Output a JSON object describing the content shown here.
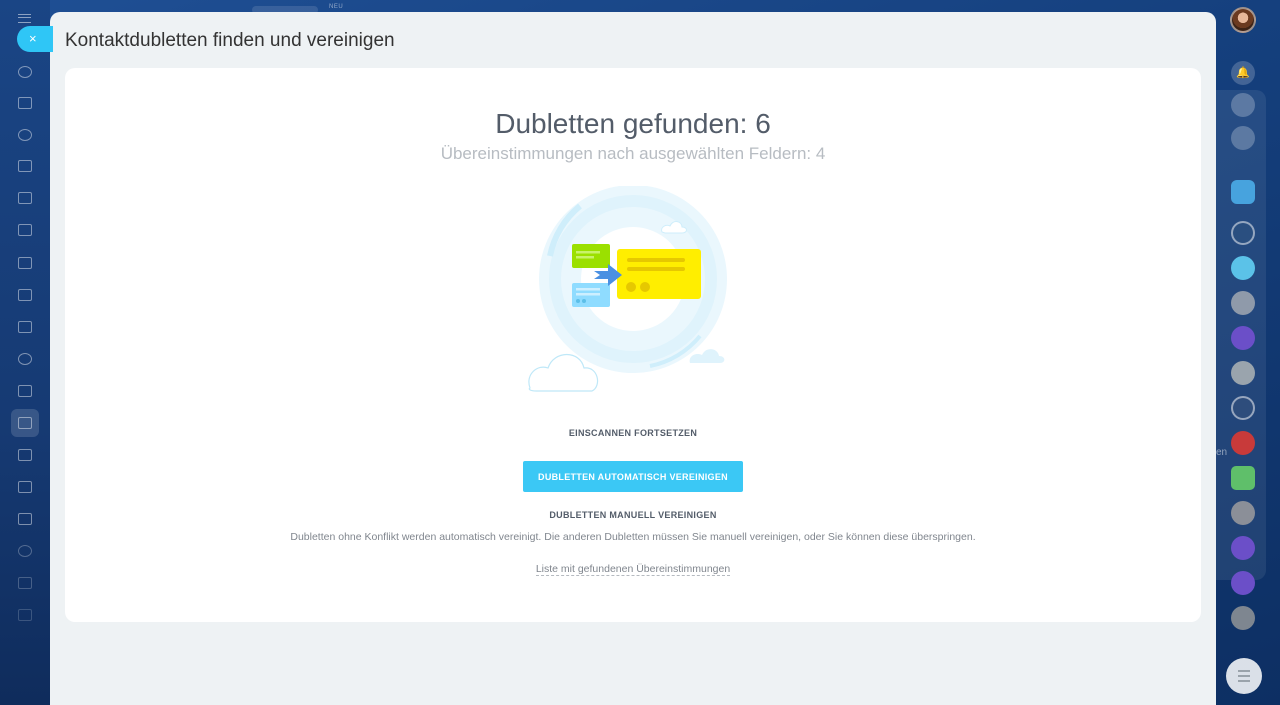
{
  "topbar": {
    "new_badge": "NEU"
  },
  "slider": {
    "title": "Kontaktdubletten finden und vereinigen",
    "close_symbol": "×"
  },
  "result": {
    "headline": "Dubletten gefunden: 6",
    "subline": "Übereinstimmungen nach ausgewählten Feldern: 4"
  },
  "actions": {
    "continue_scan": "EINSCANNEN FORTSETZEN",
    "auto_merge": "DUBLETTEN AUTOMATISCH VEREINIGEN",
    "manual_merge": "DUBLETTEN MANUELL VEREINIGEN"
  },
  "description": "Dubletten ohne Konflikt werden automatisch vereinigt. Die anderen Dubletten müssen Sie manuell vereinigen, oder Sie können diese überspringen.",
  "match_list_link": "Liste mit gefundenen Übereinstimmungen",
  "right_panel": {
    "clipped_label": "en"
  },
  "colors": {
    "accent": "#3bc8f5",
    "green_card": "#9be000",
    "yellow_card": "#ffee00",
    "blue_card": "#8fdcff",
    "arrow": "#4a90e2"
  },
  "icons": {
    "close": "close-icon",
    "menu": "hamburger-icon",
    "notifications": "bell-icon"
  }
}
